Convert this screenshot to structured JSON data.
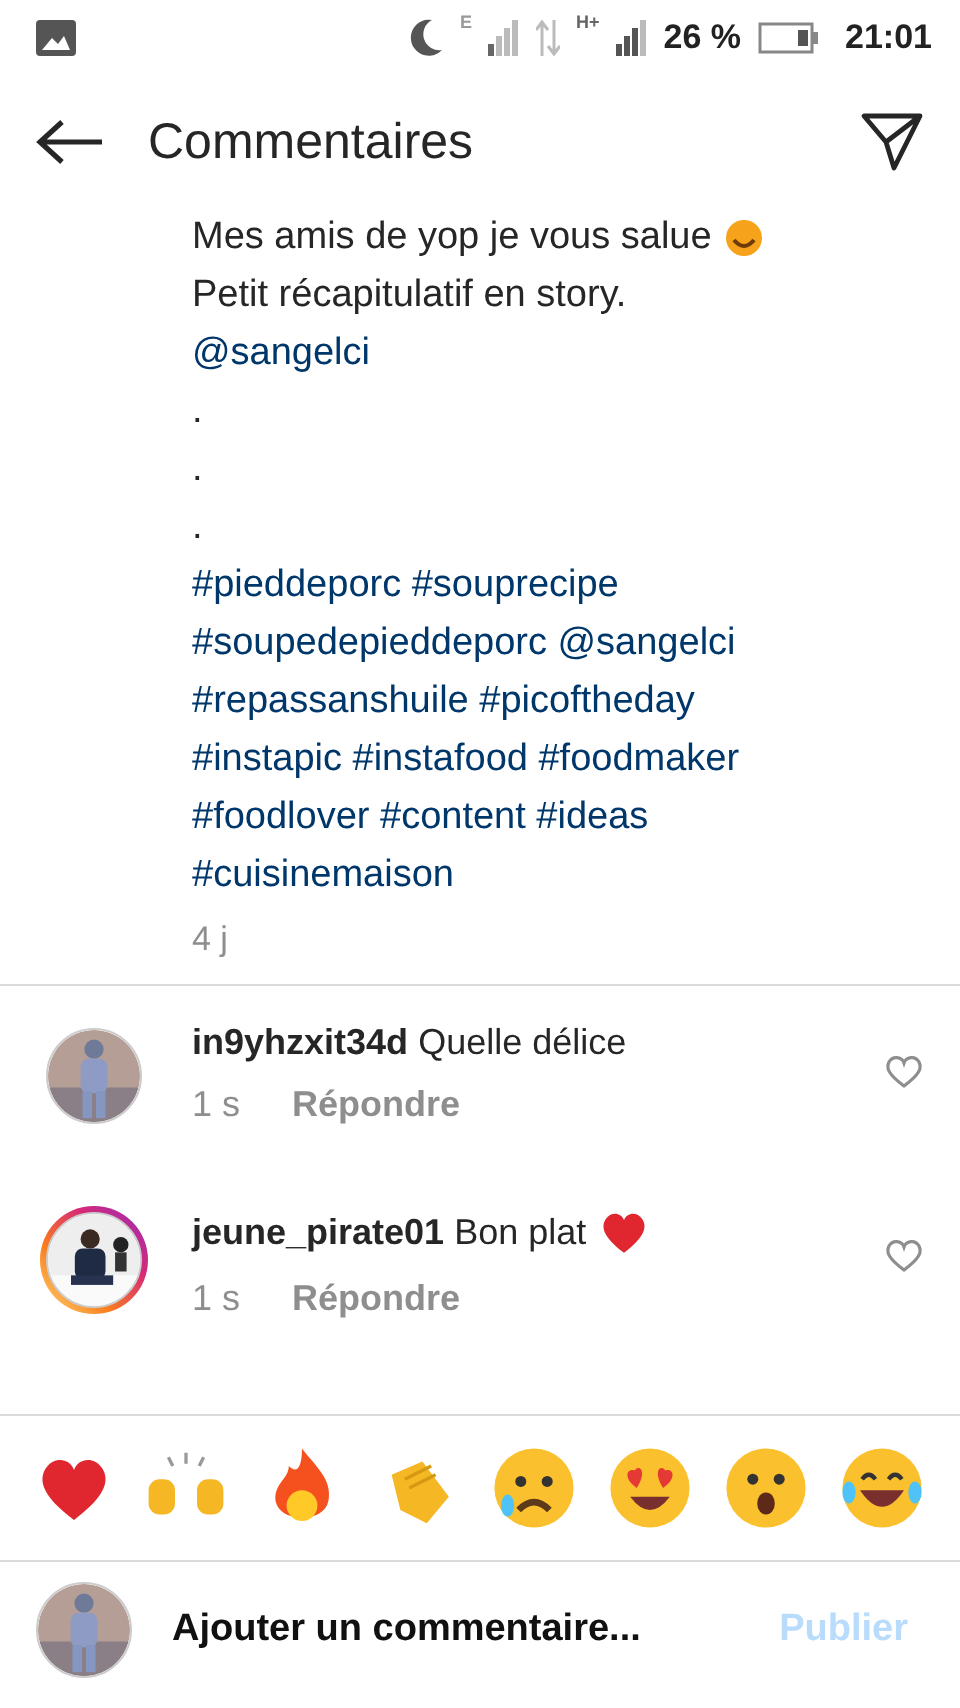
{
  "status_bar": {
    "network_1": "E",
    "network_2": "H+",
    "battery": "26 %",
    "time": "21:01"
  },
  "header": {
    "title": "Commentaires"
  },
  "caption": {
    "lines": [
      {
        "kind": "text",
        "text": "Mes amis de yop je vous salue",
        "emoji": true
      },
      {
        "kind": "text",
        "text": "Petit récapitulatif en story."
      },
      {
        "kind": "link",
        "text": "@sangelci"
      },
      {
        "kind": "text",
        "text": "."
      },
      {
        "kind": "text",
        "text": "."
      },
      {
        "kind": "text",
        "text": "."
      },
      {
        "kind": "link",
        "text": "#pieddeporc #souprecipe"
      },
      {
        "kind": "link",
        "text": "#soupedepieddeporc @sangelci"
      },
      {
        "kind": "link",
        "text": "#repassanshuile #picoftheday"
      },
      {
        "kind": "link",
        "text": "#instapic #instafood #foodmaker"
      },
      {
        "kind": "link",
        "text": "#foodlover #content #ideas"
      },
      {
        "kind": "link",
        "text": "#cuisinemaison"
      }
    ],
    "time": "4 j"
  },
  "comments": [
    {
      "user": "in9yhzxit34d",
      "text": "Quelle délice",
      "heart_emoji": false,
      "has_story": false,
      "time": "1 s",
      "reply": "Répondre",
      "liked": false
    },
    {
      "user": "jeune_pirate01",
      "text": "Bon plat",
      "heart_emoji": true,
      "has_story": true,
      "time": "1 s",
      "reply": "Répondre",
      "liked": false
    }
  ],
  "composer": {
    "placeholder": "Ajouter un commentaire...",
    "post": "Publier",
    "post_enabled": false
  }
}
